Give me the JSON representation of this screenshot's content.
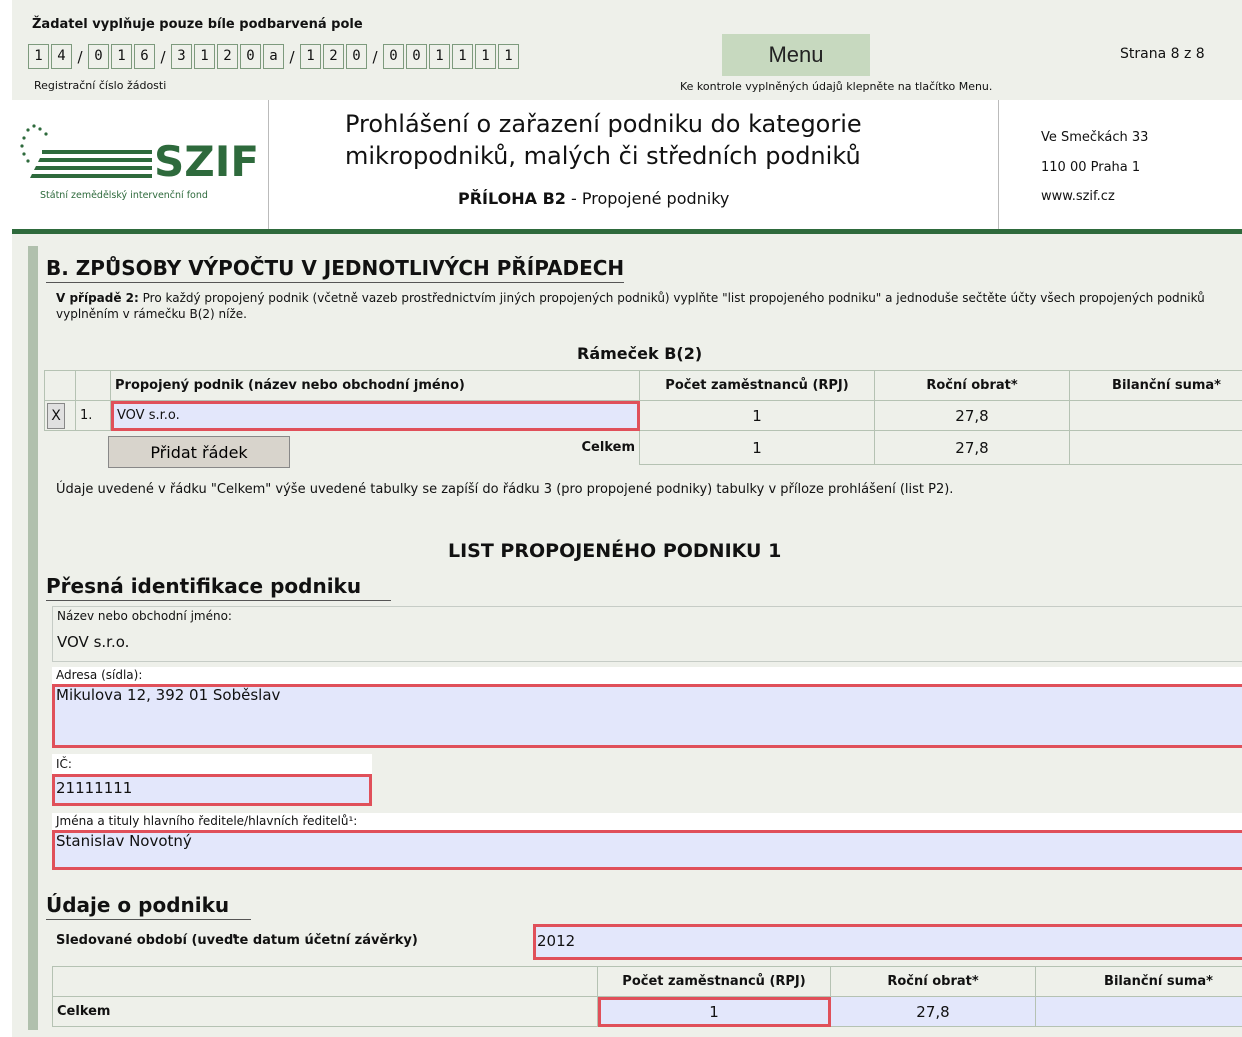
{
  "top": {
    "instruction": "Žadatel vyplňuje pouze bíle podbarvená pole",
    "reg_groups": [
      [
        "1",
        "4"
      ],
      [
        "0",
        "1",
        "6"
      ],
      [
        "3",
        "1",
        "2",
        "0",
        "a"
      ],
      [
        "1",
        "2",
        "0"
      ],
      [
        "0",
        "0",
        "1",
        "1",
        "1",
        "1"
      ]
    ],
    "reg_label": "Registrační číslo žádosti",
    "menu_label": "Menu",
    "page_label": "Strana 8 z 8",
    "check_hint": "Ke kontrole vyplněných údajů klepněte na tlačítko Menu."
  },
  "header": {
    "logo_text": "SZIF",
    "logo_subtitle": "Státní zemědělský intervenční fond",
    "title_line1": "Prohlášení o zařazení podniku do kategorie",
    "title_line2": "mikropodniků, malých či středních podniků",
    "annex_bold": "PŘÍLOHA B2",
    "annex_rest": " - Propojené podniky",
    "address_line1": "Ve Smečkách 33",
    "address_line2": "110 00 Praha 1",
    "address_line3": "www.szif.cz"
  },
  "section_b": {
    "title": "B. ZPŮSOBY VÝPOČTU V JEDNOTLIVÝCH PŘÍPADECH",
    "case_bold": "V případě 2:",
    "case_text": " Pro každý propojený podnik (včetně vazeb prostřednictvím jiných propojených podniků) vyplňte \"list propojeného podniku\" a jednoduše sečtěte účty všech propojených podniků vyplněním v rámečku B(2) níže.",
    "frame_title": "Rámeček B(2)",
    "columns": [
      "Propojený podnik (název nebo obchodní jméno)",
      "Počet zaměstnanců (RPJ)",
      "Roční obrat*",
      "Bilanční suma*"
    ],
    "rows": [
      {
        "x": "X",
        "num": "1.",
        "name": "VOV s.r.o.",
        "employees": "1",
        "turnover": "27,8",
        "balance": ""
      }
    ],
    "add_row_label": "Přidat řádek",
    "total_label": "Celkem",
    "total_employees": "1",
    "total_turnover": "27,8",
    "total_balance": "",
    "note": "Údaje uvedené v řádku \"Celkem\" výše uvedené tabulky se zapíší do řádku 3 (pro propojené podniky) tabulky v příloze prohlášení (list P2)."
  },
  "list": {
    "title": "LIST PROPOJENÉHO PODNIKU 1",
    "ident_title": "Přesná identifikace podniku",
    "name_label": "Název nebo obchodní jméno:",
    "name_value": "VOV s.r.o.",
    "address_label": "Adresa (sídla):",
    "address_value": "Mikulova 12, 392 01 Soběslav",
    "ic_label": "IČ:",
    "ic_value": "21111111",
    "directors_label": "Jména a tituly hlavního ředitele/hlavních ředitelů¹:",
    "directors_value": "Stanislav Novotný"
  },
  "company": {
    "title": "Údaje o podniku",
    "period_label": "Sledované období (uveďte datum účetní závěrky)",
    "period_value": "2012",
    "columns": [
      "",
      "Počet zaměstnanců (RPJ)",
      "Roční obrat*",
      "Bilanční suma*"
    ],
    "total_label": "Celkem",
    "total_employees": "1",
    "total_turnover": "27,8",
    "total_balance": ""
  },
  "colors": {
    "page_bg": "#eef0ea",
    "field_bg": "#e3e7fb",
    "error_border": "#e0505a",
    "brand_green": "#2e6a3c",
    "menu_btn": "#c7d9bf"
  }
}
